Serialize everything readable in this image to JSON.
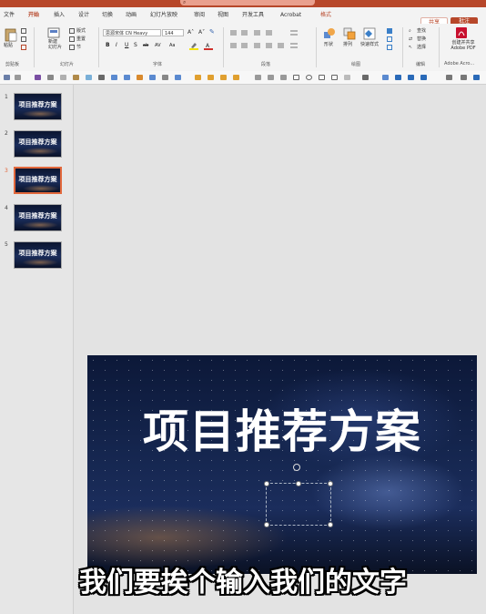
{
  "menu": {
    "tabs": [
      "文件",
      "开始",
      "插入",
      "设计",
      "切换",
      "动画",
      "幻灯片放映",
      "审阅",
      "视图",
      "开发工具",
      "Acrobat",
      "格式"
    ],
    "active_tab": "开始",
    "share_label": "共享",
    "comment_label": "批注"
  },
  "ribbon": {
    "groups": {
      "clipboard": "剪贴板",
      "slides": "幻灯片",
      "font": "字体",
      "paragraph": "段落",
      "drawing": "绘图",
      "editing": "编辑",
      "adobe": "Adobe Acro..."
    },
    "paste_label": "粘贴",
    "new_slide_label": "新建\n幻灯片",
    "layout_label": "版式",
    "reset_label": "重置",
    "section_label": "节",
    "font_name": "思源宋体 CN Heavy",
    "font_size": "144",
    "format_buttons": [
      "B",
      "I",
      "U",
      "S",
      "ab",
      "AV",
      "Aa"
    ],
    "shape_label": "形状",
    "arrange_label": "排列",
    "quick_styles_label": "快速样式",
    "find_label": "查找",
    "replace_label": "替换",
    "select_label": "选择",
    "adobe_create_label": "创建并共享\nAdobe PDF"
  },
  "thumbnails": {
    "slides": [
      {
        "num": "1",
        "title": "项目推荐方案",
        "active": false
      },
      {
        "num": "2",
        "title": "项目推荐方案",
        "active": false
      },
      {
        "num": "3",
        "title": "项目推荐方案",
        "active": true
      },
      {
        "num": "4",
        "title": "项目推荐方案",
        "active": false
      },
      {
        "num": "5",
        "title": "项目推荐方案",
        "active": false
      }
    ]
  },
  "slide": {
    "title": "项目推荐方案"
  },
  "caption": "我们要挨个输入我们的文字",
  "colors": {
    "accent": "#b7472a",
    "thumb_active_border": "#e2683c",
    "slide_bg": "#15264f"
  }
}
